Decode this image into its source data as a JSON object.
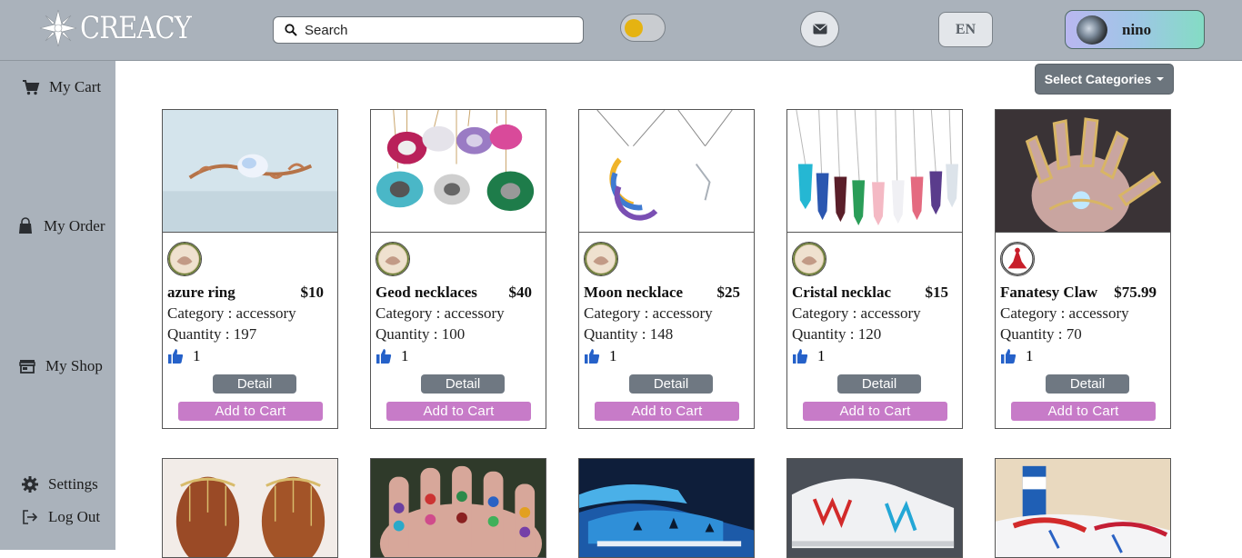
{
  "header": {
    "brand": "CREACY",
    "search_placeholder": "Search",
    "language": "EN",
    "user_name": "nino"
  },
  "sidebar": {
    "items": [
      {
        "label": "My Cart",
        "icon": "cart-icon"
      },
      {
        "label": "My Order",
        "icon": "bag-icon"
      },
      {
        "label": "My Shop",
        "icon": "store-icon"
      },
      {
        "label": "Settings",
        "icon": "gear-icon"
      },
      {
        "label": "Log Out",
        "icon": "logout-icon"
      }
    ]
  },
  "filter": {
    "categories_label": "Select Categories"
  },
  "products": [
    {
      "name": "azure ring",
      "price": "$10",
      "category": "Category : accessory",
      "quantity": "Quantity : 197",
      "likes": "1",
      "detail_label": "Detail",
      "cart_label": "Add to Cart"
    },
    {
      "name": "Geod necklaces",
      "price": "$40",
      "category": "Category : accessory",
      "quantity": "Quantity : 100",
      "likes": "1",
      "detail_label": "Detail",
      "cart_label": "Add to Cart"
    },
    {
      "name": "Moon necklace",
      "price": "$25",
      "category": "Category : accessory",
      "quantity": "Quantity : 148",
      "likes": "1",
      "detail_label": "Detail",
      "cart_label": "Add to Cart"
    },
    {
      "name": "Cristal necklac",
      "price": "$15",
      "category": "Category : accessory",
      "quantity": "Quantity : 120",
      "likes": "1",
      "detail_label": "Detail",
      "cart_label": "Add to Cart"
    },
    {
      "name": "Fanatesy Claw",
      "price": "$75.99",
      "category": "Category : accessory",
      "quantity": "Quantity : 70",
      "likes": "1",
      "detail_label": "Detail",
      "cart_label": "Add to Cart"
    }
  ],
  "colors": {
    "topbar": "#aab2bb",
    "cart_button": "#c77bc8",
    "detail_button": "#6f7882",
    "toggle_knob": "#e5b311"
  }
}
